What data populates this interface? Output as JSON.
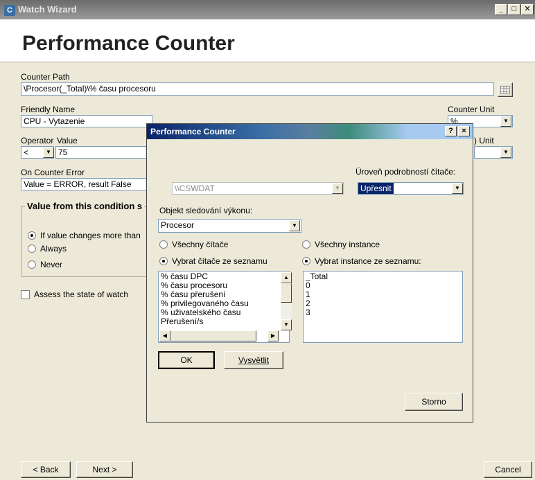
{
  "window": {
    "icon": "C",
    "title": "Watch Wizard",
    "minimize_label": "_",
    "maximize_label": "□",
    "close_label": "✕"
  },
  "header": {
    "title": "Performance Counter"
  },
  "counter_path": {
    "label": "Counter Path",
    "value": "\\Procesor(_Total)\\% času procesoru",
    "browse_icon": "grid-icon"
  },
  "friendly_name": {
    "label": "Friendly Name",
    "value": "CPU - Vytazenie"
  },
  "counter_unit": {
    "label": "Counter Unit",
    "value": "%"
  },
  "operator": {
    "label": "Operator",
    "value": "<"
  },
  "value_field": {
    "label": "Value",
    "value": "75"
  },
  "unit2": {
    "label": ") Unit"
  },
  "on_error": {
    "label": "On Counter Error",
    "value": "Value = ERROR, result False"
  },
  "condition_group": {
    "title": "Value from this condition s",
    "options": [
      {
        "label": "If value changes more than",
        "selected": true
      },
      {
        "label": "Always",
        "selected": false
      },
      {
        "label": "Never",
        "selected": false
      }
    ]
  },
  "assess": {
    "label": "Assess the state of watch",
    "checked": false
  },
  "nav": {
    "back_label": "< Back",
    "next_label": "Next >",
    "cancel_label": "Cancel"
  },
  "dialog": {
    "title": "Performance Counter",
    "help_label": "?",
    "close_label": "×",
    "computer_value": "\\\\CSWDAT",
    "detail_label": "Úroveň podrobností čítače:",
    "detail_value": "Upřesnit",
    "object_label": "Objekt sledování výkonu:",
    "object_value": "Procesor",
    "all_counters_label": "Všechny čítače",
    "select_counters_label": "Vybrat čítače ze seznamu",
    "all_instances_label": "Všechny instance",
    "select_instances_label": "Vybrat instance ze seznamu:",
    "counters": [
      "% času DPC",
      "% času procesoru",
      "% času přerušení",
      "% privilegovaného času",
      "% uživatelského času",
      "Přerušení/s"
    ],
    "instances": [
      "_Total",
      "0",
      "1",
      "2",
      "3"
    ],
    "ok_label": "OK",
    "explain_label": "Vysvětlit",
    "cancel_label": "Storno"
  }
}
